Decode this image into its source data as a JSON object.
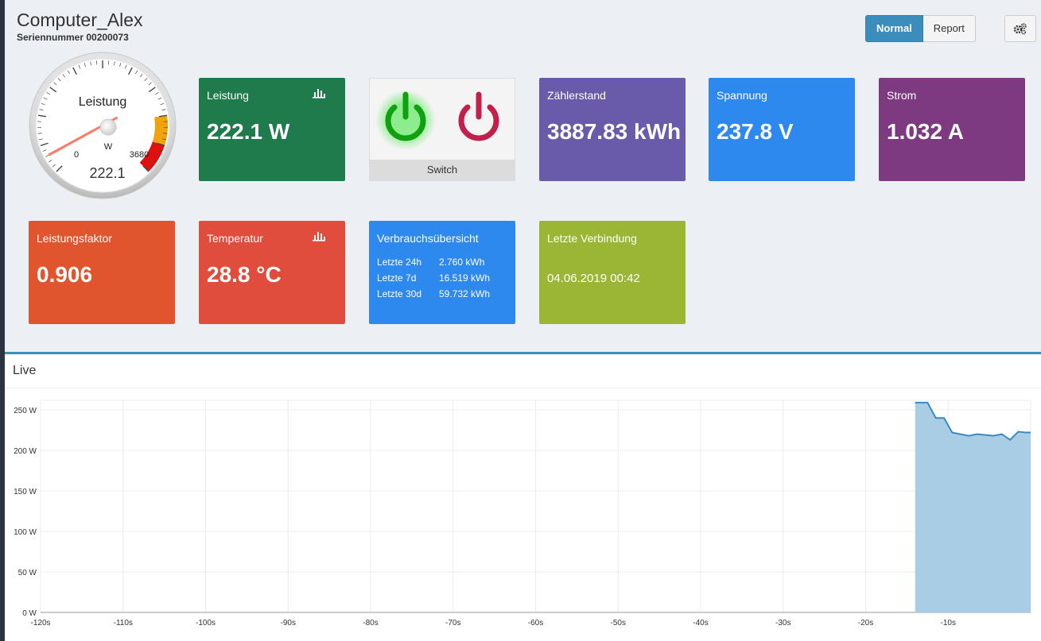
{
  "device": {
    "name": "Computer_Alex",
    "serial": "Seriennummer 00200073"
  },
  "header": {
    "mode_normal": "Normal",
    "mode_report": "Report",
    "settings_icon": "gears-icon"
  },
  "gauge": {
    "label": "Leistung",
    "unit": "W",
    "min_label": "0",
    "max_label": "3680",
    "value_text": "222.1",
    "value": 222.1,
    "max": 3680,
    "colors": {
      "orange": "#f0a30a",
      "red": "#e01010"
    }
  },
  "tiles": {
    "leistung": {
      "label": "Leistung",
      "value": "222.1 W"
    },
    "switch": {
      "label": "Switch"
    },
    "zaehlerstand": {
      "label": "Zählerstand",
      "value": "3887.83 kWh"
    },
    "spannung": {
      "label": "Spannung",
      "value": "237.8 V"
    },
    "strom": {
      "label": "Strom",
      "value": "1.032 A"
    },
    "leistungsfaktor": {
      "label": "Leistungsfaktor",
      "value": "0.906"
    },
    "temperatur": {
      "label": "Temperatur",
      "value": "28.8 °C"
    },
    "verbrauch": {
      "label": "Verbrauchsübersicht",
      "rows": [
        {
          "k": "Letzte 24h",
          "v": "2.760 kWh"
        },
        {
          "k": "Letzte 7d",
          "v": "16.519 kWh"
        },
        {
          "k": "Letzte 30d",
          "v": "59.732 kWh"
        }
      ]
    },
    "verbindung": {
      "label": "Letzte Verbindung",
      "value": "04.06.2019 00:42"
    }
  },
  "colors": {
    "accent": "#3c8dbc",
    "green_on": "#10a010",
    "red_off": "#c0204a",
    "area": "#a9cde4",
    "line": "#3a8ac0"
  },
  "live": {
    "title": "Live"
  },
  "chart_data": {
    "type": "area",
    "xlabel": "",
    "ylabel": "",
    "xlim": [
      -120,
      0
    ],
    "ylim": [
      0,
      250
    ],
    "x_ticks": [
      "-120s",
      "-110s",
      "-100s",
      "-90s",
      "-80s",
      "-70s",
      "-60s",
      "-50s",
      "-40s",
      "-30s",
      "-20s",
      "-10s"
    ],
    "x_tick_values": [
      -120,
      -110,
      -100,
      -90,
      -80,
      -70,
      -60,
      -50,
      -40,
      -30,
      -20,
      -10
    ],
    "y_ticks": [
      "0 W",
      "50 W",
      "100 W",
      "150 W",
      "200 W",
      "250 W"
    ],
    "y_tick_values": [
      0,
      50,
      100,
      150,
      200,
      250
    ],
    "series": [
      {
        "x": [
          -13.5,
          -12.5,
          -11.5,
          -10.5,
          -9.5,
          -8.5,
          -7.5,
          -6.5,
          -5.5,
          -4.5,
          -3.5,
          -2.5,
          -1.5,
          -0.5
        ],
        "y": [
          259,
          259,
          240,
          240,
          222,
          220,
          218,
          220,
          219,
          218,
          220,
          213,
          223,
          222
        ]
      }
    ]
  }
}
